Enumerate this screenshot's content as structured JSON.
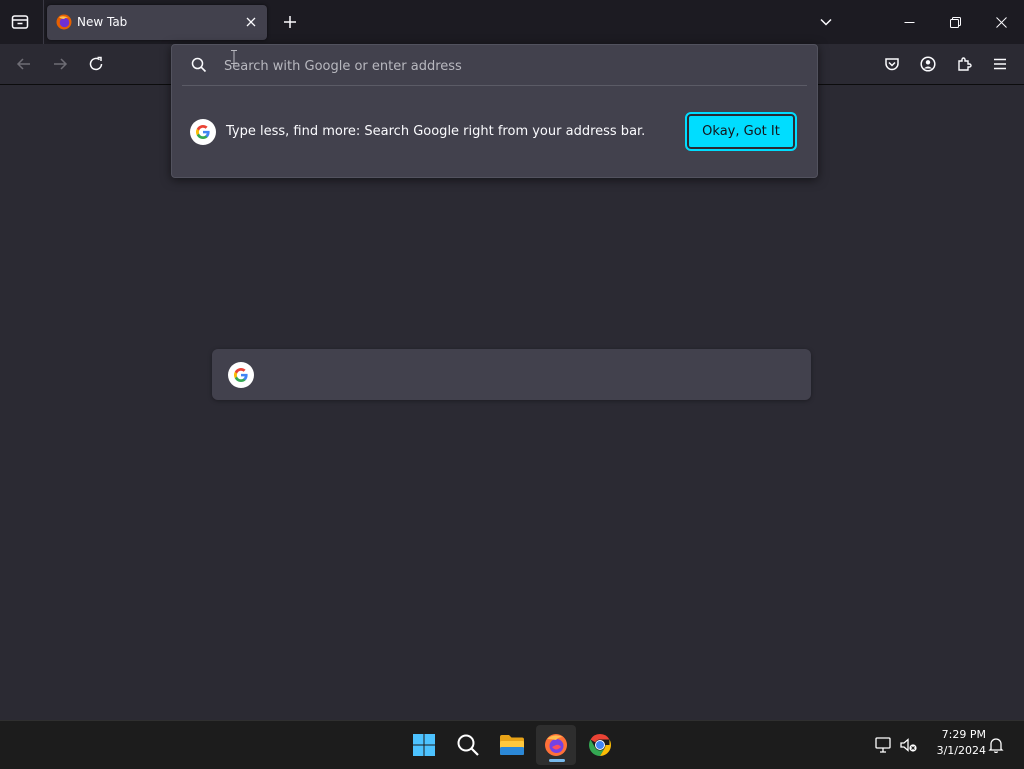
{
  "window": {
    "tab_title": "New Tab",
    "list_all_tabs_icon": "chevron-down-icon",
    "new_tab_icon": "plus-icon"
  },
  "toolbar": {
    "back_icon": "arrow-left-icon",
    "forward_icon": "arrow-right-icon",
    "reload_icon": "reload-icon",
    "pocket_icon": "pocket-icon",
    "account_icon": "account-icon",
    "extensions_icon": "puzzle-icon",
    "menu_icon": "hamburger-icon"
  },
  "urlbar": {
    "placeholder": "Search with Google or enter address",
    "value": ""
  },
  "tip": {
    "text": "Type less, find more: Search Google right from your address bar.",
    "button_label": "Okay, Got It"
  },
  "taskbar": {
    "time": "7:29 PM",
    "date": "3/1/2024"
  },
  "colors": {
    "accent": "#00ddff",
    "background": "#2b2a33",
    "panel": "#42414d",
    "titlebar": "#1c1b22"
  }
}
